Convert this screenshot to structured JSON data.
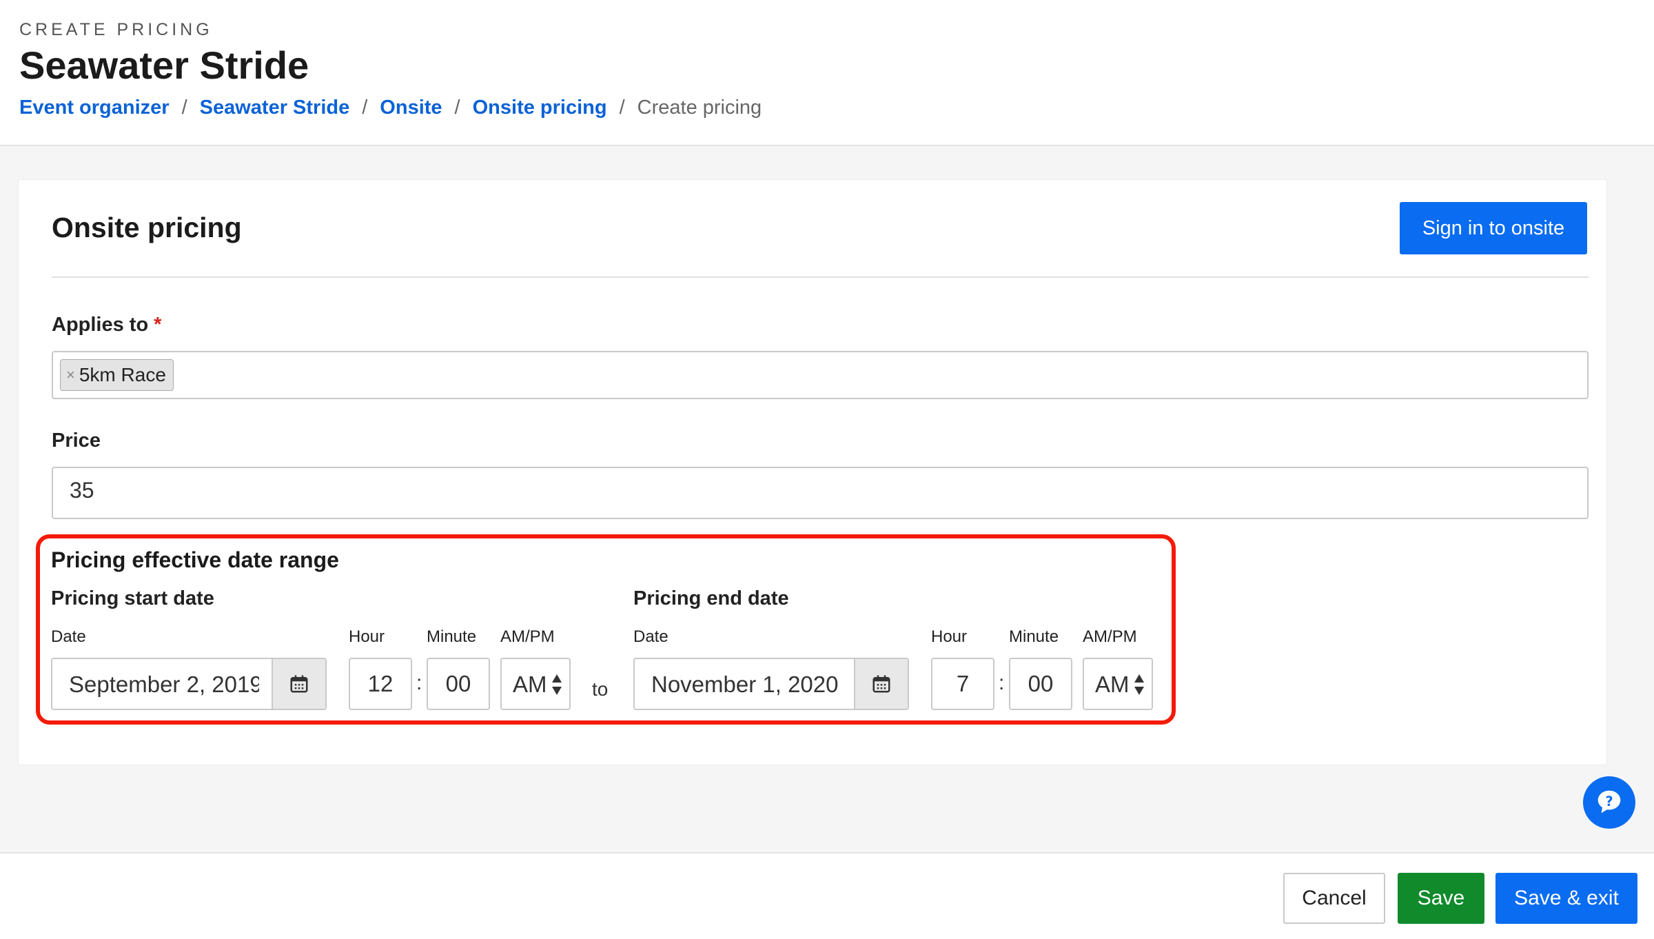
{
  "header": {
    "eyebrow": "CREATE PRICING",
    "title": "Seawater Stride",
    "breadcrumb": [
      "Event organizer",
      "Seawater Stride",
      "Onsite",
      "Onsite pricing"
    ],
    "breadcrumb_current": "Create pricing",
    "separator": "/"
  },
  "card": {
    "title": "Onsite pricing",
    "sign_in_button": "Sign in to onsite",
    "applies_to": {
      "label": "Applies to",
      "required_mark": "*",
      "tags": [
        "5km Race"
      ],
      "remove_glyph": "×"
    },
    "price": {
      "label": "Price",
      "value": "35"
    },
    "date_range": {
      "title": "Pricing effective date range",
      "to_label": "to",
      "start": {
        "title": "Pricing start date",
        "date_label": "Date",
        "date_value": "September 2, 2019",
        "hour_label": "Hour",
        "hour_value": "12",
        "minute_label": "Minute",
        "minute_value": "00",
        "ampm_label": "AM/PM",
        "ampm_value": "AM"
      },
      "end": {
        "title": "Pricing end date",
        "date_label": "Date",
        "date_value": "November 1, 2020",
        "hour_label": "Hour",
        "hour_value": "7",
        "minute_label": "Minute",
        "minute_value": "00",
        "ampm_label": "AM/PM",
        "ampm_value": "AM"
      },
      "colon": ":"
    }
  },
  "footer": {
    "cancel": "Cancel",
    "save": "Save",
    "save_exit": "Save & exit"
  },
  "colors": {
    "primary": "#0a6cf0",
    "success": "#108a2b",
    "highlight": "#f31b07",
    "link": "#0b62d6"
  },
  "icons": {
    "calendar": "calendar-icon",
    "help": "help-chat-icon",
    "select_arrows": "select-arrows-icon"
  }
}
